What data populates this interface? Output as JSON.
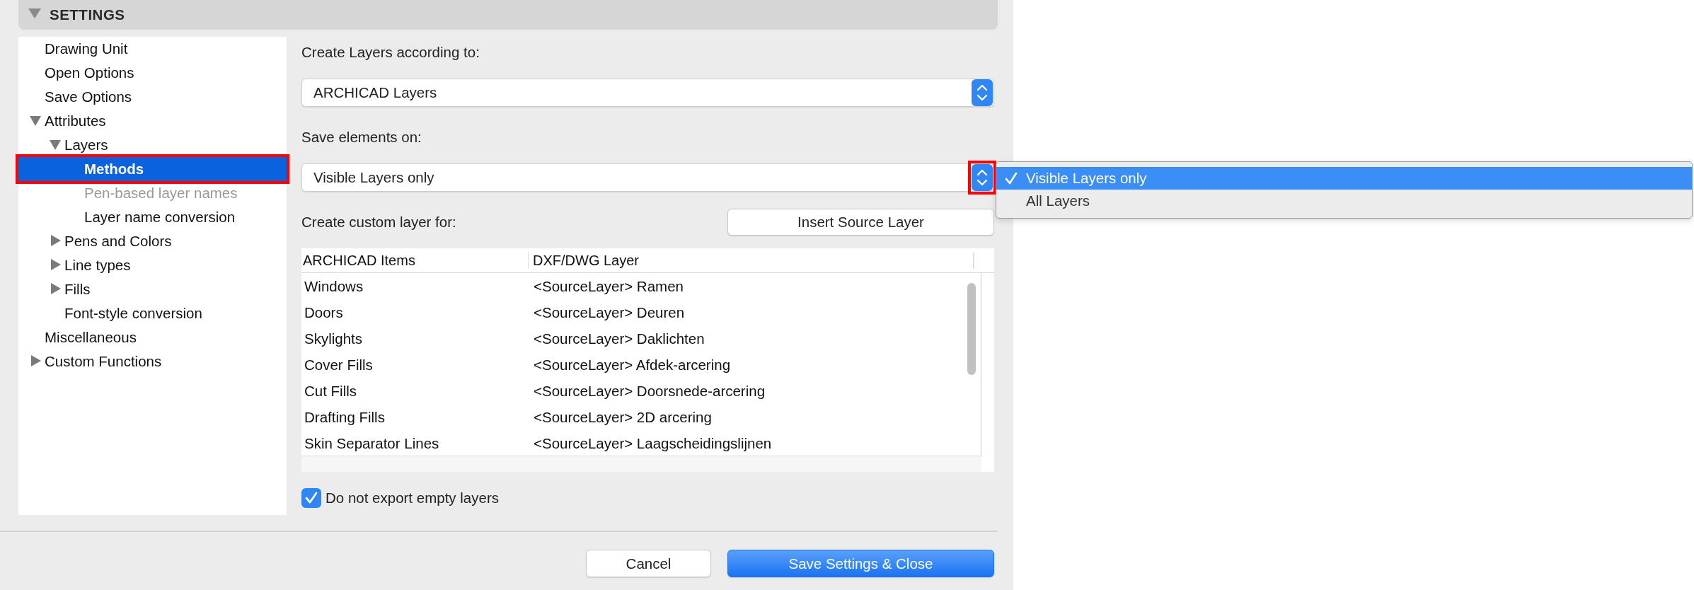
{
  "header": {
    "title": "SETTINGS",
    "expanded": true
  },
  "sidebar": {
    "items": [
      {
        "label": "Drawing Unit",
        "selected": false,
        "disabled": false,
        "highlighted": false
      },
      {
        "label": "Open Options",
        "selected": false,
        "disabled": false,
        "highlighted": false
      },
      {
        "label": "Save Options",
        "selected": false,
        "disabled": false,
        "highlighted": false
      },
      {
        "label": "Attributes",
        "expanded": true,
        "selected": false,
        "disabled": false,
        "highlighted": false,
        "children": [
          {
            "label": "Layers",
            "expanded": true,
            "selected": false,
            "disabled": false,
            "highlighted": false,
            "children": [
              {
                "label": "Methods",
                "selected": true,
                "disabled": false,
                "highlighted": true
              },
              {
                "label": "Pen-based layer names",
                "selected": false,
                "disabled": true,
                "highlighted": false
              },
              {
                "label": "Layer name conversion",
                "selected": false,
                "disabled": false,
                "highlighted": false
              }
            ]
          },
          {
            "label": "Pens and Colors",
            "expanded": false,
            "selected": false,
            "disabled": false,
            "highlighted": false
          },
          {
            "label": "Line types",
            "expanded": false,
            "selected": false,
            "disabled": false,
            "highlighted": false
          },
          {
            "label": "Fills",
            "expanded": false,
            "selected": false,
            "disabled": false,
            "highlighted": false
          },
          {
            "label": "Font-style conversion",
            "selected": false,
            "disabled": false,
            "highlighted": false
          }
        ]
      },
      {
        "label": "Miscellaneous",
        "selected": false,
        "disabled": false,
        "highlighted": false
      },
      {
        "label": "Custom Functions",
        "expanded": false,
        "selected": false,
        "disabled": false,
        "highlighted": false
      }
    ]
  },
  "layers_source": {
    "label": "Create Layers according to:",
    "value": "ARCHICAD Layers",
    "highlighted": false
  },
  "save_elements": {
    "label": "Save elements on:",
    "value": "Visible Layers only",
    "highlighted": true,
    "open": true,
    "options": [
      {
        "label": "Visible Layers only",
        "selected": true
      },
      {
        "label": "All Layers",
        "selected": false
      }
    ]
  },
  "custom_layer": {
    "label": "Create custom layer for:",
    "button": "Insert Source Layer"
  },
  "table": {
    "columns": [
      "ARCHICAD Items",
      "DXF/DWG Layer"
    ],
    "rows": [
      [
        "Windows",
        "<SourceLayer> Ramen"
      ],
      [
        "Doors",
        "<SourceLayer> Deuren"
      ],
      [
        "Skylights",
        "<SourceLayer> Daklichten"
      ],
      [
        "Cover Fills",
        "<SourceLayer> Afdek-arcering"
      ],
      [
        "Cut Fills",
        "<SourceLayer> Doorsnede-arcering"
      ],
      [
        "Drafting Fills",
        "<SourceLayer> 2D arcering"
      ],
      [
        "Skin Separator Lines",
        "<SourceLayer> Laagscheidingslijnen"
      ]
    ]
  },
  "export_empty": {
    "label": "Do not export empty layers",
    "checked": true
  },
  "buttons": [
    {
      "label": "Cancel",
      "kind": "default"
    },
    {
      "label": "Save Settings & Close",
      "kind": "primary"
    }
  ]
}
